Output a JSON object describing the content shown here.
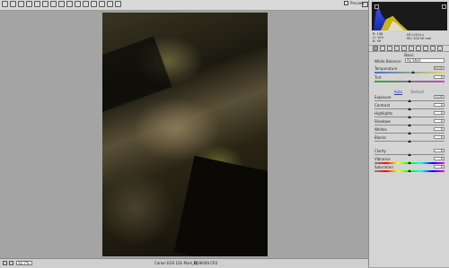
{
  "toolbar": {
    "tools": [
      "zoom-icon",
      "hand-icon",
      "white-balance-icon",
      "color-sampler-icon",
      "target-adjust-icon",
      "crop-icon",
      "straighten-icon",
      "spot-removal-icon",
      "red-eye-icon",
      "adjustment-brush-icon",
      "graduated-filter-icon",
      "radial-filter-icon",
      "preferences-icon",
      "rotate-ccw-icon",
      "rotate-cw-icon"
    ],
    "preview_label": "Preview",
    "preview_checked": true
  },
  "status": {
    "zoom_value": "32.7%",
    "file_name": "Canon EOS 1Ds Mark III",
    "file_meta": "_DJS8049.CR2"
  },
  "readout": {
    "r": "R: 138",
    "g": "G: 109",
    "b": "B: 59",
    "exif_1": "f/8  1/320 s",
    "exif_2": "ISO 100  50 mm"
  },
  "panel": {
    "section_title": "Basic",
    "white_balance_label": "White Balance:",
    "white_balance_value": "As Shot",
    "auto_label": "Auto",
    "default_label": "Default",
    "sliders": {
      "temperature": {
        "label": "Temperature",
        "value": "5100",
        "pos": 0.55
      },
      "tint": {
        "label": "Tint",
        "value": "0",
        "pos": 0.5
      },
      "exposure": {
        "label": "Exposure",
        "value": "0.00",
        "pos": 0.5
      },
      "contrast": {
        "label": "Contrast",
        "value": "0",
        "pos": 0.5
      },
      "highlights": {
        "label": "Highlights",
        "value": "0",
        "pos": 0.5
      },
      "shadows": {
        "label": "Shadows",
        "value": "0",
        "pos": 0.5
      },
      "whites": {
        "label": "Whites",
        "value": "0",
        "pos": 0.5
      },
      "blacks": {
        "label": "Blacks",
        "value": "0",
        "pos": 0.5
      },
      "clarity": {
        "label": "Clarity",
        "value": "0",
        "pos": 0.5
      },
      "vibrance": {
        "label": "Vibrance",
        "value": "0",
        "pos": 0.5
      },
      "saturation": {
        "label": "Saturation",
        "value": "0",
        "pos": 0.5
      }
    }
  },
  "colors": {
    "panel_bg": "#d4d4d4",
    "canvas_bg": "#a4a4a4",
    "accent_link": "#1e3e9f"
  }
}
